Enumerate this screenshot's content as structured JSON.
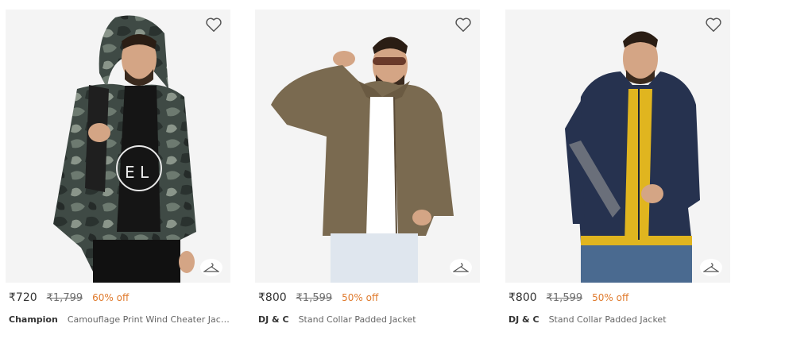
{
  "products": [
    {
      "price": "₹720",
      "mrp": "₹1,799",
      "discount": "60% off",
      "brand": "Champion",
      "title": "Camouflage Print Wind Cheater Jack…",
      "jacket_color": "#3f4a45",
      "jacket_pattern": "camouflage",
      "inner_color": "#1a1a1a"
    },
    {
      "price": "₹800",
      "mrp": "₹1,599",
      "discount": "50% off",
      "brand": "DJ & C",
      "title": "Stand Collar Padded Jacket",
      "jacket_color": "#7a6a50",
      "jacket_pattern": "solid",
      "inner_color": "#ffffff"
    },
    {
      "price": "₹800",
      "mrp": "₹1,599",
      "discount": "50% off",
      "brand": "DJ & C",
      "title": "Stand Collar Padded Jacket",
      "jacket_color": "#26324f",
      "jacket_pattern": "solid",
      "inner_color": "#e0b51f"
    }
  ],
  "icons": {
    "wishlist": "heart-icon",
    "similar": "hanger-icon"
  },
  "colors": {
    "discount": "#e07a2c",
    "image_bg": "#f4f4f4"
  }
}
